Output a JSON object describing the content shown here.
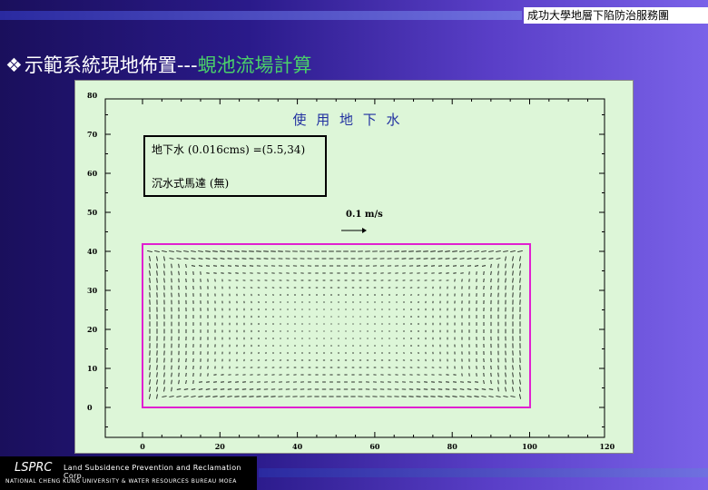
{
  "header": {
    "org_name": "成功大學地層下陷防治服務團"
  },
  "slide": {
    "title_bullet": "❖",
    "title_main": "示範系統現地佈置---",
    "title_highlight": "蜆池流場計算"
  },
  "figure": {
    "plot_title": "使 用 地 下 水",
    "legend": {
      "line1": "地下水 (0.016cms) =(5.5,34)",
      "line2": "沉水式馬達 (無)"
    },
    "scale_label": "0.1  m/s",
    "x_ticks": [
      "0",
      "20",
      "40",
      "60",
      "80",
      "100",
      "120"
    ],
    "y_ticks": [
      "0",
      "10",
      "20",
      "30",
      "40",
      "50",
      "60",
      "70",
      "80"
    ],
    "colors": {
      "pond_outline": "#e020d0",
      "vectors": "#000000",
      "plot_bg": "#ddf6d8"
    }
  },
  "footer": {
    "brand": "LSPRC",
    "company": "Land Subsidence Prevention and Reclamation Corp.",
    "university": "NATIONAL CHENG KUNG UNIVERSITY & WATER RESOURCES BUREAU  MOEA"
  }
}
